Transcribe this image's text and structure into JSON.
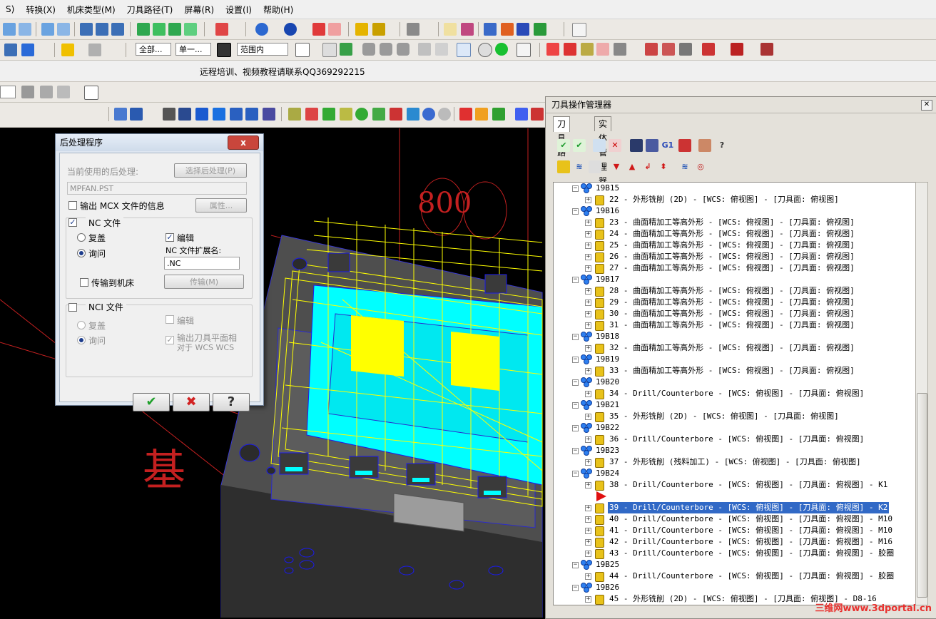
{
  "menubar": {
    "items": [
      "S)",
      "转换(X)",
      "机床类型(M)",
      "刀具路径(T)",
      "屏幕(R)",
      "设置(I)",
      "帮助(H)"
    ]
  },
  "toolbar": {
    "combo_all": "全部...",
    "combo_single": "单一...",
    "combo_range": "范围内",
    "ticker": "远程培训、视频教程请联系QQ369292215"
  },
  "dialog": {
    "title": "后处理程序",
    "close_label": "x",
    "current_post_label": "当前使用的后处理:",
    "select_post_button": "选择后处理(P)",
    "post_name": "MPFAN.PST",
    "output_mcx_label": "输出 MCX 文件的信息",
    "properties_button": "属性...",
    "nc_file_label": "NC 文件",
    "overwrite_label": "复盖",
    "ask_label": "询问",
    "edit_label": "编辑",
    "nc_ext_label": "NC 文件扩展名:",
    "nc_ext_value": ".NC",
    "send_to_machine_label": "传输到机床",
    "transfer_button": "传输(M)",
    "nci_file_label": "NCI 文件",
    "nci_overwrite_label": "复盖",
    "nci_ask_label": "询问",
    "nci_edit_label": "编辑",
    "nci_output_plane_label_1": "输出刀具平面相",
    "nci_output_plane_label_2": "对于 WCS WCS",
    "ok_glyph": "✔",
    "cancel_glyph": "✖",
    "help_glyph": "?"
  },
  "panel": {
    "title": "刀具操作管理器",
    "close_glyph": "✕",
    "tab_toolpaths": "刀具路径",
    "tab_solids": "实体管理器",
    "g1_label": "G1",
    "rows": [
      {
        "type": "group",
        "label": "19B15"
      },
      {
        "type": "op",
        "label": "22 - 外形铣削 (2D) - [WCS: 俯视图] - [刀具面: 俯视图]"
      },
      {
        "type": "group",
        "label": "19B16"
      },
      {
        "type": "op",
        "label": "23 - 曲面精加工等高外形 - [WCS: 俯视图] - [刀具面: 俯视图]"
      },
      {
        "type": "op",
        "label": "24 - 曲面精加工等高外形 - [WCS: 俯视图] - [刀具面: 俯视图]"
      },
      {
        "type": "op",
        "label": "25 - 曲面精加工等高外形 - [WCS: 俯视图] - [刀具面: 俯视图]"
      },
      {
        "type": "op",
        "label": "26 - 曲面精加工等高外形 - [WCS: 俯视图] - [刀具面: 俯视图]"
      },
      {
        "type": "op",
        "label": "27 - 曲面精加工等高外形 - [WCS: 俯视图] - [刀具面: 俯视图]"
      },
      {
        "type": "group",
        "label": "19B17"
      },
      {
        "type": "op",
        "label": "28 - 曲面精加工等高外形 - [WCS: 俯视图] - [刀具面: 俯视图]"
      },
      {
        "type": "op",
        "label": "29 - 曲面精加工等高外形 - [WCS: 俯视图] - [刀具面: 俯视图]"
      },
      {
        "type": "op",
        "label": "30 - 曲面精加工等高外形 - [WCS: 俯视图] - [刀具面: 俯视图]"
      },
      {
        "type": "op",
        "label": "31 - 曲面精加工等高外形 - [WCS: 俯视图] - [刀具面: 俯视图]"
      },
      {
        "type": "group",
        "label": "19B18"
      },
      {
        "type": "op",
        "label": "32 - 曲面精加工等高外形 - [WCS: 俯视图] - [刀具面: 俯视图]"
      },
      {
        "type": "group",
        "label": "19B19"
      },
      {
        "type": "op",
        "label": "33 - 曲面精加工等高外形 - [WCS: 俯视图] - [刀具面: 俯视图]"
      },
      {
        "type": "group",
        "label": "19B20"
      },
      {
        "type": "op",
        "label": "34 - Drill/Counterbore - [WCS: 俯视图] - [刀具面: 俯视图]"
      },
      {
        "type": "group",
        "label": "19B21"
      },
      {
        "type": "op",
        "label": "35 - 外形铣削 (2D) - [WCS: 俯视图] - [刀具面: 俯视图]"
      },
      {
        "type": "group",
        "label": "19B22"
      },
      {
        "type": "op",
        "label": "36 - Drill/Counterbore - [WCS: 俯视图] - [刀具面: 俯视图]"
      },
      {
        "type": "group",
        "label": "19B23"
      },
      {
        "type": "op",
        "label": "37 - 外形铣削 (残料加工) - [WCS: 俯视图] - [刀具面: 俯视图]"
      },
      {
        "type": "group",
        "label": "19B24"
      },
      {
        "type": "op",
        "label": "38 - Drill/Counterbore - [WCS: 俯视图] - [刀具面: 俯视图] - K1"
      },
      {
        "type": "marker",
        "label": ""
      },
      {
        "type": "op",
        "label": "39 - Drill/Counterbore - [WCS: 俯视图] - [刀具面: 俯视图] - K2",
        "selected": true
      },
      {
        "type": "op",
        "label": "40 - Drill/Counterbore - [WCS: 俯视图] - [刀具面: 俯视图] - M10"
      },
      {
        "type": "op",
        "label": "41 - Drill/Counterbore - [WCS: 俯视图] - [刀具面: 俯视图] - M10"
      },
      {
        "type": "op",
        "label": "42 - Drill/Counterbore - [WCS: 俯视图] - [刀具面: 俯视图] - M16"
      },
      {
        "type": "op",
        "label": "43 - Drill/Counterbore - [WCS: 俯视图] - [刀具面: 俯视图] - 胶圈"
      },
      {
        "type": "group",
        "label": "19B25"
      },
      {
        "type": "op",
        "label": "44 - Drill/Counterbore - [WCS: 俯视图] - [刀具面: 俯视图] - 胶圈"
      },
      {
        "type": "group",
        "label": "19B26"
      },
      {
        "type": "op",
        "label": "45 - 外形铣削 (2D) - [WCS: 俯视图] - [刀具面: 俯视图] - D8-16"
      }
    ]
  },
  "viewport": {
    "red_text": "基",
    "text_800": "800",
    "watermark": "三维网www.3dportal.cn"
  },
  "colors": {
    "toolpath_yellow": "#ffff00",
    "surface_cyan": "#00ffff",
    "part_gray": "#5e5e5e",
    "selection_blue": "#3169c6"
  }
}
